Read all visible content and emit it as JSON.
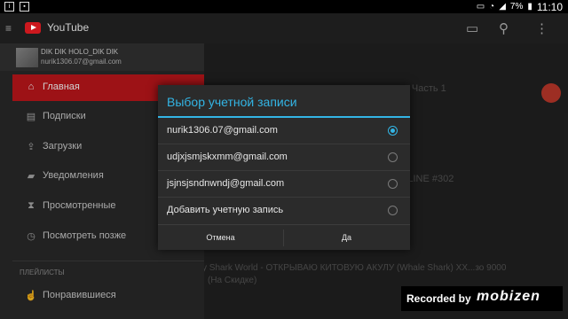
{
  "status_bar": {
    "time": "11:10",
    "battery": "7%"
  },
  "app": {
    "title": "YouTube"
  },
  "account": {
    "name": "DIK DIK HOLO_DIK DIK",
    "email": "nurik1306.07@gmail.com"
  },
  "drawer": {
    "items": [
      {
        "label": "Главная",
        "icon": "home-icon",
        "active": true
      },
      {
        "label": "Подписки",
        "icon": "subscriptions-icon"
      },
      {
        "label": "Загрузки",
        "icon": "uploads-icon"
      },
      {
        "label": "Уведомления",
        "icon": "bell-icon"
      },
      {
        "label": "Просмотренные",
        "icon": "history-icon"
      },
      {
        "label": "Посмотреть позже",
        "icon": "clock-icon"
      }
    ],
    "section_label": "ПЛЕЙЛИСТЫ",
    "playlist_item": {
      "label": "Понравившиеся",
      "icon": "thumb-up-icon"
    }
  },
  "dialog": {
    "title": "Выбор учетной записи",
    "options": [
      {
        "label": "nurik1306.07@gmail.com",
        "selected": true
      },
      {
        "label": "udjxjsmjskxmm@gmail.com",
        "selected": false
      },
      {
        "label": "jsjnsjsndnwndj@gmail.com",
        "selected": false
      },
      {
        "label": "Добавить учетную запись",
        "selected": false
      }
    ],
    "cancel_label": "Отмена",
    "ok_label": "Да"
  },
  "background": {
    "line1": "а - Часть 1",
    "line2": "TA 5 ONLINE #302",
    "line3": "y Shark World - ОТКРЫВАЮ КИТОВУЮ АКУЛУ (Whale Shark) XX...зо 9000",
    "line4": "(На Скидке)"
  },
  "watermark": {
    "text": "Recorded by",
    "logo": "mobizen"
  },
  "colors": {
    "accent": "#33b5e5",
    "brand_red": "#c0171c"
  }
}
